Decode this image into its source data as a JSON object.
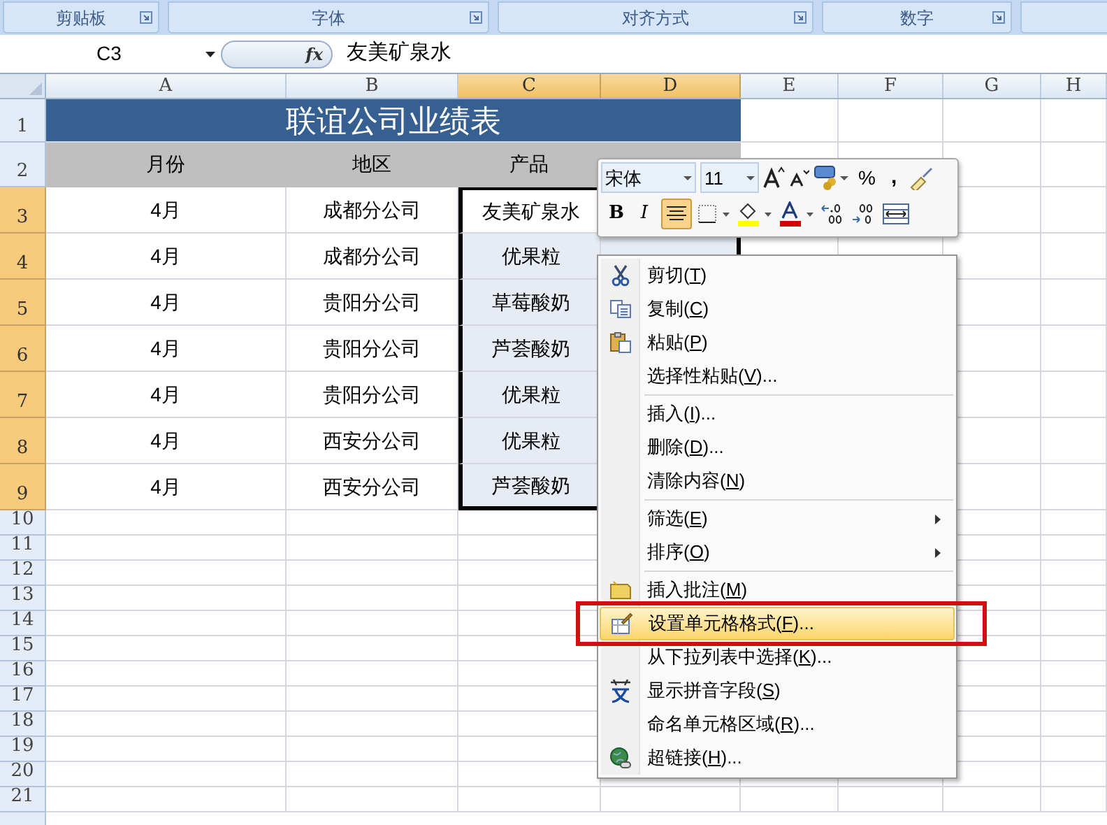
{
  "ribbon_groups": [
    {
      "label": "剪贴板"
    },
    {
      "label": "字体"
    },
    {
      "label": "对齐方式"
    },
    {
      "label": "数字"
    }
  ],
  "formula_bar": {
    "name_box": "C3",
    "fx": "fx",
    "value": "友美矿泉水"
  },
  "columns": [
    {
      "label": "A",
      "selected": false
    },
    {
      "label": "B",
      "selected": false
    },
    {
      "label": "C",
      "selected": true,
      "active": true
    },
    {
      "label": "D",
      "selected": true,
      "active": false
    },
    {
      "label": "E",
      "selected": false
    },
    {
      "label": "F",
      "selected": false
    },
    {
      "label": "G",
      "selected": false
    },
    {
      "label": "H",
      "selected": false
    }
  ],
  "rows": [
    {
      "header": "1",
      "kind": "title",
      "selected": false,
      "title": "联谊公司业绩表"
    },
    {
      "header": "2",
      "kind": "heading",
      "selected": false,
      "cells": [
        "月份",
        "地区",
        "产品"
      ]
    },
    {
      "header": "3",
      "kind": "data",
      "selected": true,
      "active": true,
      "cells": [
        "4月",
        "成都分公司",
        "友美矿泉水"
      ]
    },
    {
      "header": "4",
      "kind": "data",
      "selected": true,
      "active": false,
      "cells": [
        "4月",
        "成都分公司",
        "优果粒"
      ]
    },
    {
      "header": "5",
      "kind": "data",
      "selected": true,
      "active": false,
      "cells": [
        "4月",
        "贵阳分公司",
        "草莓酸奶"
      ]
    },
    {
      "header": "6",
      "kind": "data",
      "selected": true,
      "active": false,
      "cells": [
        "4月",
        "贵阳分公司",
        "芦荟酸奶"
      ]
    },
    {
      "header": "7",
      "kind": "data",
      "selected": true,
      "active": false,
      "cells": [
        "4月",
        "贵阳分公司",
        "优果粒"
      ]
    },
    {
      "header": "8",
      "kind": "data",
      "selected": true,
      "active": false,
      "cells": [
        "4月",
        "西安分公司",
        "优果粒"
      ]
    },
    {
      "header": "9",
      "kind": "data",
      "selected": true,
      "active": false,
      "cells": [
        "4月",
        "西安分公司",
        "芦荟酸奶"
      ]
    },
    {
      "header": "10",
      "kind": "empty",
      "selected": false
    },
    {
      "header": "11",
      "kind": "empty",
      "selected": false
    },
    {
      "header": "12",
      "kind": "empty",
      "selected": false
    },
    {
      "header": "13",
      "kind": "empty",
      "selected": false
    },
    {
      "header": "14",
      "kind": "empty",
      "selected": false
    },
    {
      "header": "15",
      "kind": "empty",
      "selected": false
    },
    {
      "header": "16",
      "kind": "empty",
      "selected": false
    },
    {
      "header": "17",
      "kind": "empty",
      "selected": false
    },
    {
      "header": "18",
      "kind": "empty",
      "selected": false
    },
    {
      "header": "19",
      "kind": "empty",
      "selected": false
    },
    {
      "header": "20",
      "kind": "empty",
      "selected": false
    },
    {
      "header": "21",
      "kind": "empty",
      "selected": false
    }
  ],
  "mini_toolbar": {
    "font": "宋体",
    "size": "11",
    "percent": "%",
    "comma": ",",
    "bold": "B",
    "italic": "I",
    "align_center_selected": true
  },
  "context_menu": [
    {
      "kind": "item",
      "before": "剪切(",
      "key": "T",
      "after": ")",
      "submenu": false,
      "highlighted": false
    },
    {
      "kind": "item",
      "before": "复制(",
      "key": "C",
      "after": ")",
      "submenu": false,
      "highlighted": false
    },
    {
      "kind": "item",
      "before": "粘贴(",
      "key": "P",
      "after": ")",
      "submenu": false,
      "highlighted": false
    },
    {
      "kind": "item",
      "before": "选择性粘贴(",
      "key": "V",
      "after": ")...",
      "submenu": false,
      "highlighted": false
    },
    {
      "kind": "separator"
    },
    {
      "kind": "item",
      "before": "插入(",
      "key": "I",
      "after": ")...",
      "submenu": false,
      "highlighted": false
    },
    {
      "kind": "item",
      "before": "删除(",
      "key": "D",
      "after": ")...",
      "submenu": false,
      "highlighted": false
    },
    {
      "kind": "item",
      "before": "清除内容(",
      "key": "N",
      "after": ")",
      "submenu": false,
      "highlighted": false
    },
    {
      "kind": "separator"
    },
    {
      "kind": "item",
      "before": "筛选(",
      "key": "E",
      "after": ")",
      "submenu": true,
      "highlighted": false
    },
    {
      "kind": "item",
      "before": "排序(",
      "key": "O",
      "after": ")",
      "submenu": true,
      "highlighted": false
    },
    {
      "kind": "separator"
    },
    {
      "kind": "item",
      "before": "插入批注(",
      "key": "M",
      "after": ")",
      "submenu": false,
      "highlighted": false
    },
    {
      "kind": "item",
      "before": "设置单元格格式(",
      "key": "F",
      "after": ")...",
      "submenu": false,
      "highlighted": true
    },
    {
      "kind": "item",
      "before": "从下拉列表中选择(",
      "key": "K",
      "after": ")...",
      "submenu": false,
      "highlighted": false
    },
    {
      "kind": "item",
      "before": "显示拼音字段(",
      "key": "S",
      "after": ")",
      "submenu": false,
      "highlighted": false
    },
    {
      "kind": "item",
      "before": "命名单元格区域(",
      "key": "R",
      "after": ")...",
      "submenu": false,
      "highlighted": false
    },
    {
      "kind": "item",
      "before": "超链接(",
      "key": "H",
      "after": ")...",
      "submenu": false,
      "highlighted": false
    }
  ]
}
